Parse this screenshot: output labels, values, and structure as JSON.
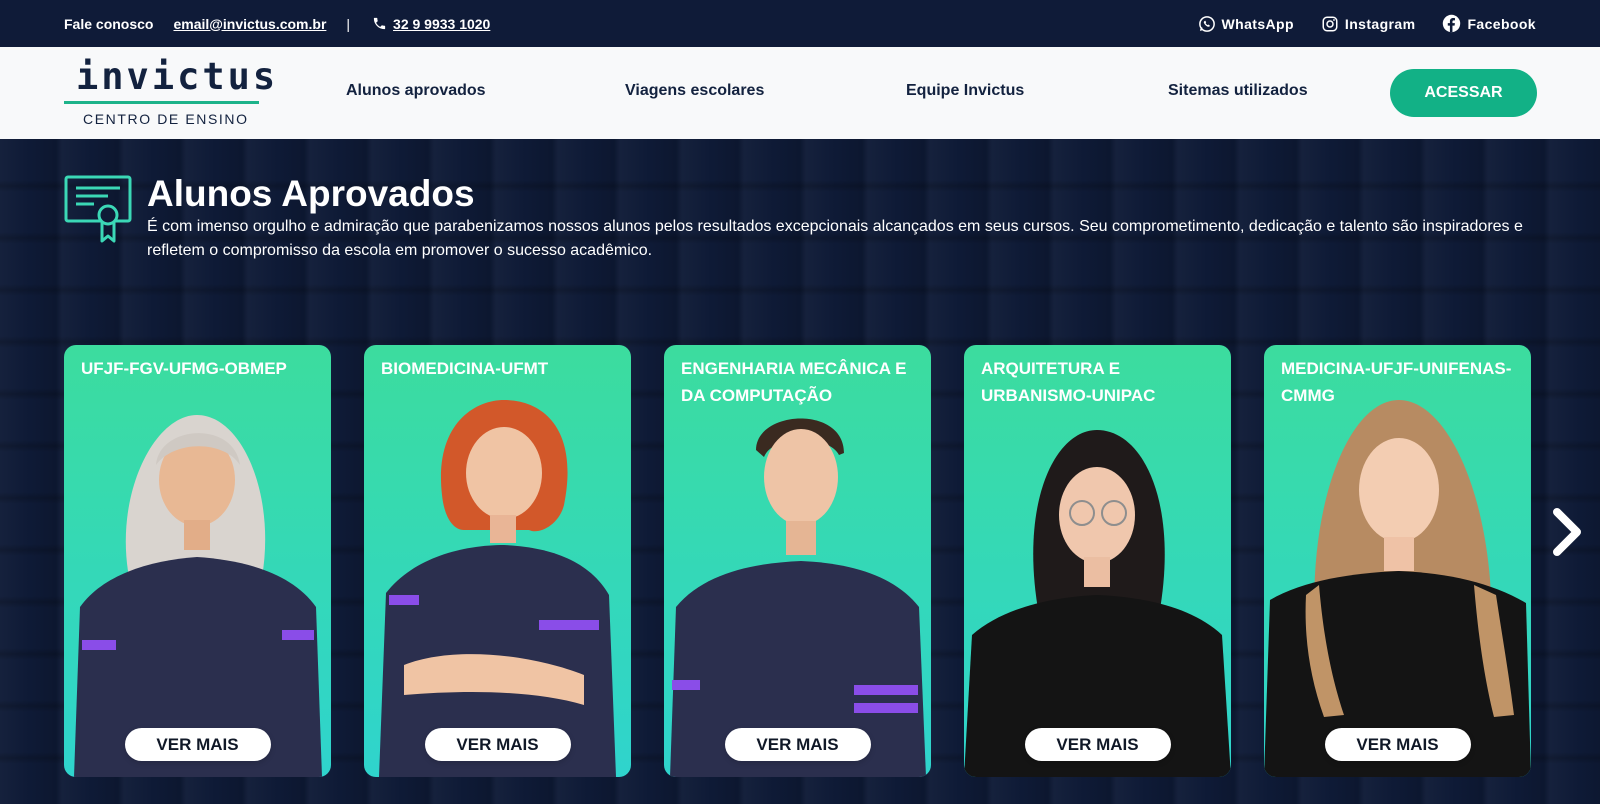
{
  "topbar": {
    "contact_label": "Fale conosco",
    "email": "email@invictus.com.br",
    "separator": "|",
    "phone": "32 9 9933 1020",
    "socials": [
      {
        "icon": "whatsapp-icon",
        "label": "WhatsApp"
      },
      {
        "icon": "instagram-icon",
        "label": "Instagram"
      },
      {
        "icon": "facebook-icon",
        "label": "Facebook"
      }
    ]
  },
  "nav": {
    "logo_word": "invictus",
    "logo_sub": "CENTRO DE ENSINO",
    "items": [
      "Alunos aprovados",
      "Viagens escolares",
      "Equipe Invictus",
      "Sitemas utilizados"
    ],
    "cta": "ACESSAR"
  },
  "hero": {
    "icon": "certificate-icon",
    "title": "Alunos Aprovados",
    "description": "É com imenso orgulho e admiração que parabenizamos nossos alunos pelos resultados excepcionais alcançados em seus cursos. Seu comprometimento, dedicação e talento são inspiradores e refletem o compromisso da escola em promover o sucesso acadêmico."
  },
  "cards": [
    {
      "label": "UFJF-FGV-UFMG-OBMEP",
      "button": "VER MAIS"
    },
    {
      "label": "BIOMEDICINA-UFMT",
      "button": "VER MAIS"
    },
    {
      "label": "ENGENHARIA MECÂNICA E DA COMPUTAÇÃO",
      "button": "VER MAIS"
    },
    {
      "label": "ARQUITETURA E URBANISMO-UNIPAC",
      "button": "VER MAIS"
    },
    {
      "label": "MEDICINA-UFJF-UNIFENAS-CMMG",
      "button": "VER MAIS"
    }
  ],
  "colors": {
    "navy": "#0f1b38",
    "accent": "#12b186",
    "card_top": "#3cdc9e",
    "card_bottom": "#2fd4cd"
  }
}
